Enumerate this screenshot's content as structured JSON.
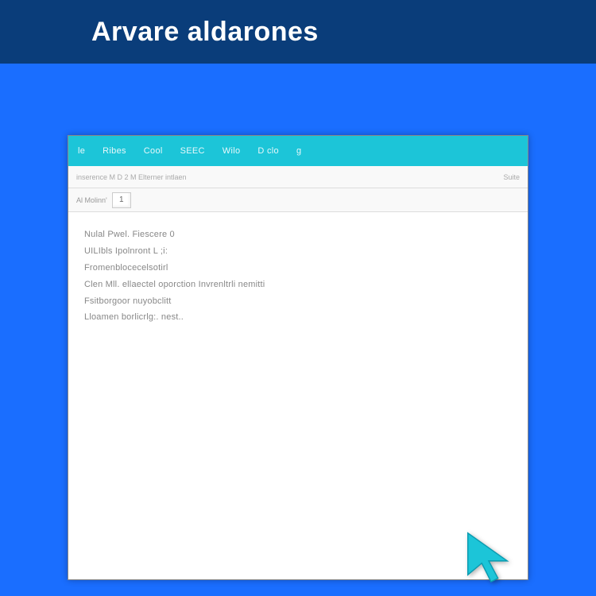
{
  "header": {
    "title": "Arvare aldarones"
  },
  "window": {
    "menubar": {
      "items": [
        "le",
        "Ribes",
        "Cool",
        "SEEC",
        "Wilo",
        "D   clo",
        "g"
      ]
    },
    "toolbar": {
      "left_text": "inserence M  D 2 M Elterner  intlaen",
      "right_text": "Suite"
    },
    "secondary": {
      "label": "Al   Molinn'",
      "page_value": "1"
    },
    "content": {
      "lines": [
        "Nulal Pwel.  Fiescere   0",
        "UILIbls Ipolnront L  ;i:",
        "Fromenblocecelsotirl",
        "Clen  Mll.  ellaectel oporction   Invrenltrli nemitti",
        "Fsitborgoor  nuyobclitt",
        "Lloamen  borlicrlg:.    nest.."
      ]
    }
  }
}
